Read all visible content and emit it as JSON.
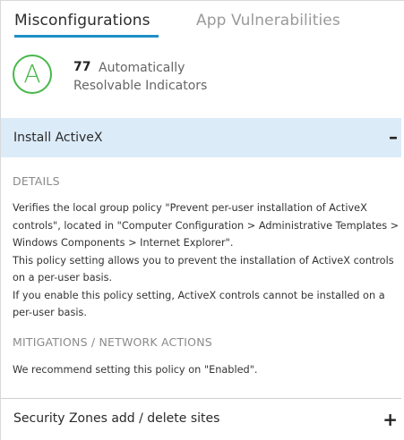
{
  "tabs": [
    {
      "label": "Misconfigurations",
      "active": true
    },
    {
      "label": "App Vulnerabilities",
      "active": false
    }
  ],
  "summary": {
    "grade": "A",
    "count": "77",
    "label_line1": "Automatically",
    "label_line2": "Resolvable Indicators"
  },
  "accordion": [
    {
      "title": "Install ActiveX",
      "expanded": true,
      "toggle_icon": "–",
      "details_heading": "DETAILS",
      "details_lines": [
        "Verifies the local group policy \"Prevent per-user installation of ActiveX",
        "controls\", located in \"Computer Configuration > Administrative Templates >",
        "Windows Components > Internet Explorer\".",
        "This policy setting allows you to prevent the installation of ActiveX controls",
        "on a per-user basis.",
        "If you enable this policy setting, ActiveX controls cannot be installed on a",
        "per-user basis."
      ],
      "mitigations_heading": "MITIGATIONS / NETWORK ACTIONS",
      "mitigation_text": "We recommend setting this policy on \"Enabled\"."
    },
    {
      "title": "Security Zones add / delete sites",
      "expanded": false,
      "toggle_icon": "+"
    }
  ],
  "colors": {
    "accent": "#1e8fc6",
    "grade_green": "#48b84a",
    "expanded_bg": "#dcebf8"
  }
}
